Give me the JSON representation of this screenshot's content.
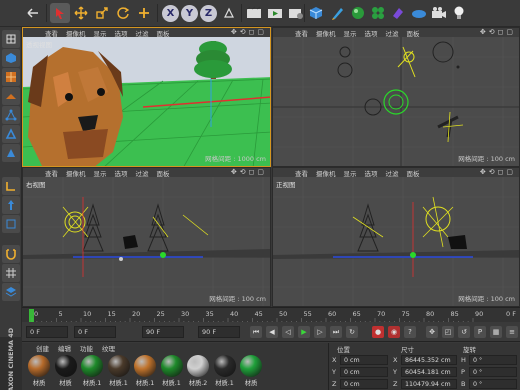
{
  "toolbar": {
    "buttons": [
      "undo-icon",
      "select-icon",
      "move-icon",
      "scale-icon",
      "rotate-icon",
      "add-icon",
      "x-axis-lock",
      "y-axis-lock",
      "z-axis-lock",
      "world-coords-icon",
      "render-view-icon",
      "render-icon",
      "render-settings-icon",
      "cube-icon",
      "pen-icon",
      "subdivision-icon",
      "array-icon",
      "deformer-icon",
      "floor-icon",
      "camera-icon",
      "light-icon"
    ],
    "axis_labels": [
      "X",
      "Y",
      "Z"
    ]
  },
  "viewports": {
    "menu": [
      "查看",
      "摄像机",
      "显示",
      "选项",
      "过滤",
      "面板"
    ],
    "perspective": {
      "title": "透视视图",
      "grid": "网格间距 : 1000 cm"
    },
    "top": {
      "title": "",
      "grid": "网格间距 : 100 cm"
    },
    "right": {
      "title": "右视图",
      "grid": "网格间距 : 100 cm"
    },
    "front": {
      "title": "正视图",
      "grid": "网格间距 : 100 cm"
    }
  },
  "timeline": {
    "ticks": [
      "0",
      "5",
      "10",
      "15",
      "20",
      "25",
      "30",
      "35",
      "40",
      "45",
      "50",
      "55",
      "60",
      "65",
      "70",
      "75",
      "80",
      "85",
      "90"
    ],
    "end_label": "0 F"
  },
  "transport": {
    "current_frame": "0 F",
    "start_frame": "0 F",
    "end_frame": "90 F",
    "max_frame": "90 F"
  },
  "materials": {
    "menu": [
      "创建",
      "编辑",
      "功能",
      "纹理"
    ],
    "items": [
      {
        "label": "材质",
        "color": "#b56a2a"
      },
      {
        "label": "材质",
        "color": "#1a1a1a"
      },
      {
        "label": "材质.1",
        "color": "#1e8a2a"
      },
      {
        "label": "材质.1",
        "color": "#4a3a2a"
      },
      {
        "label": "材质.1",
        "color": "#c0732c"
      },
      {
        "label": "材质.1",
        "color": "#1e8a2a"
      },
      {
        "label": "材质.2",
        "color": "#d0d0d0"
      },
      {
        "label": "材质.1",
        "color": "#2a2a2a"
      },
      {
        "label": "材质",
        "color": "#1fa03a"
      }
    ]
  },
  "coordinates": {
    "headers": {
      "position": "位置",
      "size": "尺寸",
      "rotation": "旋转"
    },
    "rows": [
      {
        "axis": "X",
        "position": "0 cm",
        "size_axis": "X",
        "size": "86445.352 cm",
        "rot_axis": "H",
        "rotation": "0 °"
      },
      {
        "axis": "Y",
        "position": "0 cm",
        "size_axis": "Y",
        "size": "60454.181 cm",
        "rot_axis": "P",
        "rotation": "0 °"
      },
      {
        "axis": "Z",
        "position": "0 cm",
        "size_axis": "Z",
        "size": "110479.94 cm",
        "rot_axis": "B",
        "rotation": "0 °"
      }
    ]
  },
  "brand": "MAXON CINEMA 4D"
}
